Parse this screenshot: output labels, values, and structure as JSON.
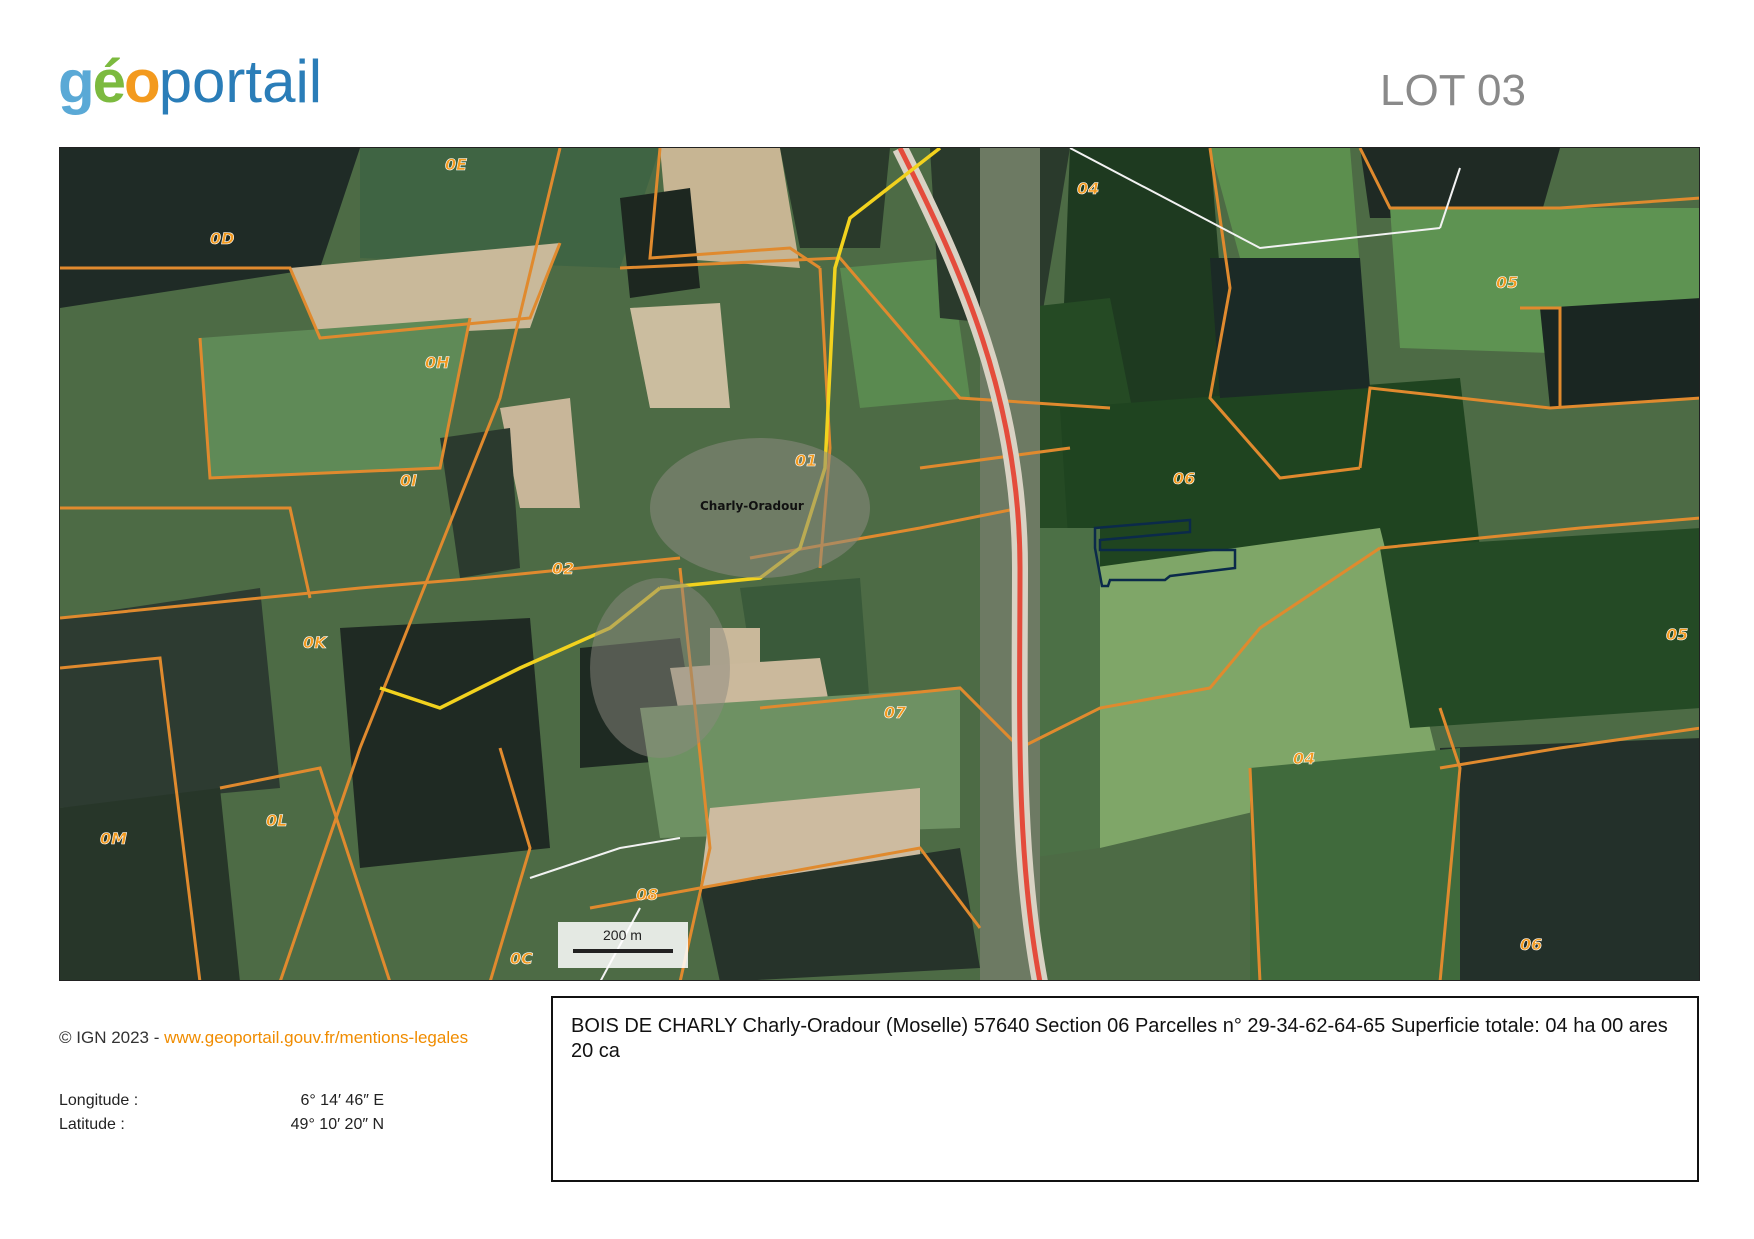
{
  "header": {
    "logo": {
      "part1": "g",
      "part2": "é",
      "part3": "o",
      "part4": "portail"
    },
    "lot_title": "LOT 03"
  },
  "map": {
    "section_labels": [
      "0E",
      "0D",
      "0H",
      "0I",
      "0K",
      "0L",
      "0M",
      "0C",
      "01",
      "02",
      "07",
      "08",
      "04",
      "05",
      "06"
    ],
    "places": {
      "village": "Charly-Oradour"
    },
    "scale_bar": {
      "label": "200 m"
    },
    "colors": {
      "parcel_border": "#e08a2e",
      "road_main": "#e44c3c",
      "road_secondary": "#f2d21e",
      "selected_parcel": "#0b2a4a"
    }
  },
  "footer": {
    "copyright_prefix": "© IGN 2023 - ",
    "copyright_link": "www.geoportail.gouv.fr/mentions-legales",
    "longitude_label": "Longitude :",
    "longitude_value": "6° 14′ 46″ E",
    "latitude_label": "Latitude :",
    "latitude_value": "49° 10′ 20″ N"
  },
  "description": "BOIS DE CHARLY Charly-Oradour (Moselle) 57640 Section 06 Parcelles n° 29-34-62-64-65 Superficie totale: 04 ha 00 ares 20 ca"
}
